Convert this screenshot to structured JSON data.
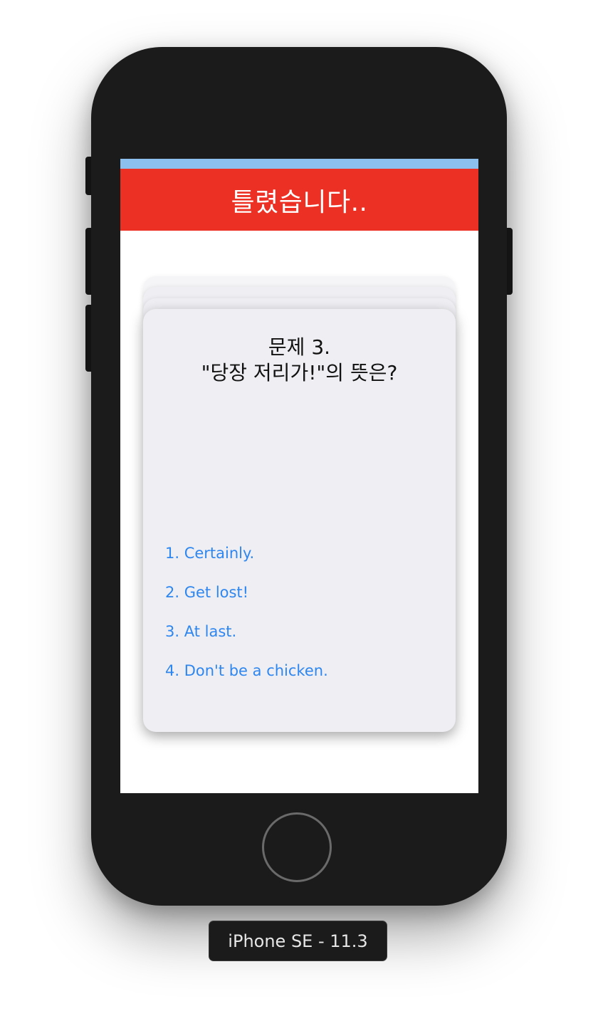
{
  "header": {
    "title": "틀렸습니다.."
  },
  "question": {
    "number": "문제 3.",
    "text": "\"당장 저리가!\"의 뜻은?"
  },
  "options": [
    "1. Certainly.",
    "2. Get lost!",
    "3. At last.",
    "4. Don't be a chicken."
  ],
  "device": {
    "label": "iPhone SE - 11.3"
  },
  "colors": {
    "header_bg": "#ec3024",
    "status_bar": "#8cbfee",
    "option_link": "#2e86f0",
    "card_bg": "#efeff3"
  }
}
